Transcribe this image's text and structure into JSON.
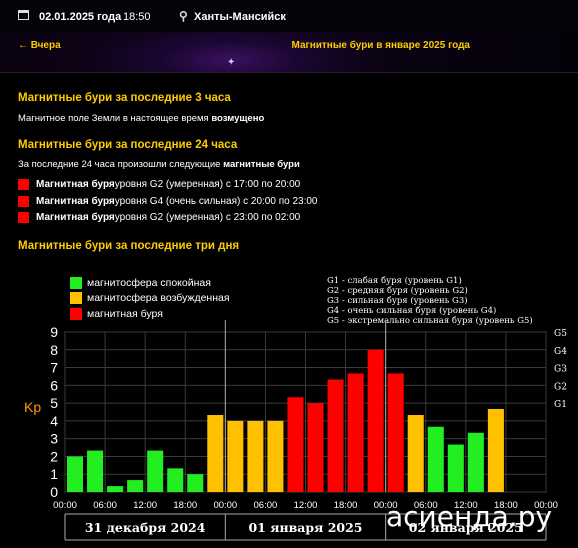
{
  "header": {
    "date": "02.01.2025 года",
    "time": "18:50",
    "city": "Ханты-Мансийск"
  },
  "nav": {
    "back_label": "← Вчера",
    "title": "Магнитные бури в январе 2025 года"
  },
  "section3h": {
    "title": "Магнитные бури за последние 3 часа",
    "text_prefix": "Магнитное поле Земли в настоящее время ",
    "text_state": "возмущено"
  },
  "section24h": {
    "title": "Магнитные бури за последние 24 часа",
    "text_prefix": "За последние 24 часа произошли следующие ",
    "text_bold": "магнитные бури",
    "storms": [
      {
        "bold": "Магнитная буря",
        "rest": " уровня G2 (умеренная) с 17:00 по 20:00"
      },
      {
        "bold": "Магнитная буря",
        "rest": " уровня G4 (очень сильная) с 20:00 по 23:00"
      },
      {
        "bold": "Магнитная буря",
        "rest": " уровня G2 (умеренная) с 23:00 по 02:00"
      }
    ]
  },
  "section3d": {
    "title": "Магнитные бури за последние три дня"
  },
  "colors": {
    "calm": "#22ee22",
    "excited": "#ffc000",
    "storm": "#ff0000",
    "accent": "#ffcc00"
  },
  "legend": {
    "calm": "магнитосфера спокойная",
    "excited": "магнитосфера возбужденная",
    "storm": "магнитная буря"
  },
  "g_levels": [
    "G1 - слабая буря (уровень G1)",
    "G2 - средняя буря (уровень G2)",
    "G3 - сильная буря (уровень G3)",
    "G4 - очень сильная буря (уровень G4)",
    "G5 - экстремально сильная буря (уровень G5)"
  ],
  "chart_data": {
    "type": "bar",
    "ylabel": "Kp",
    "ylim": [
      0,
      9
    ],
    "y_ticks": [
      "0",
      "1",
      "2",
      "3",
      "4",
      "5",
      "6",
      "7",
      "8",
      "9"
    ],
    "g_ticks": [
      {
        "label": "G1",
        "kp": 5
      },
      {
        "label": "G2",
        "kp": 6
      },
      {
        "label": "G3",
        "kp": 7
      },
      {
        "label": "G4",
        "kp": 8
      },
      {
        "label": "G5",
        "kp": 9
      }
    ],
    "x_tick_labels": [
      "00:00",
      "06:00",
      "12:00",
      "18:00",
      "00:00",
      "06:00",
      "12:00",
      "18:00",
      "00:00",
      "06:00",
      "12:00",
      "18:00",
      "00:00"
    ],
    "days": [
      "31 декабря 2024",
      "01 января 2025",
      "02 января 2025"
    ],
    "values": [
      2.0,
      2.33,
      0.33,
      0.67,
      2.33,
      1.33,
      1.0,
      4.33,
      4.0,
      4.0,
      4.0,
      5.33,
      5.0,
      6.33,
      6.67,
      8.0,
      6.67,
      4.33,
      3.67,
      2.67,
      3.33,
      4.67
    ],
    "grid": true,
    "legend_position": "top-left"
  },
  "watermark": "асиенда.ру"
}
